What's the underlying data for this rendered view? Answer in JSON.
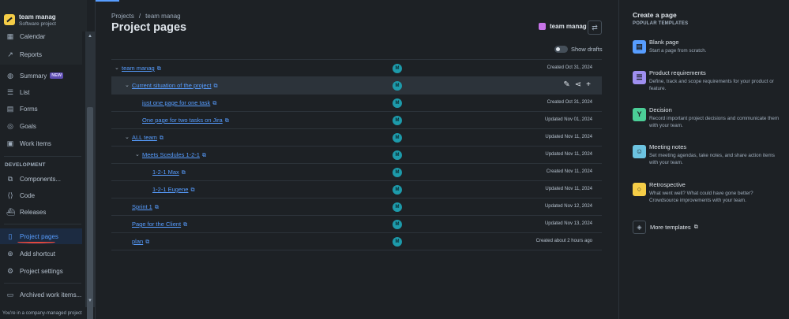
{
  "project": {
    "name": "team manag",
    "type": "Software project"
  },
  "sidebar": {
    "top_items": [
      {
        "label": "Calendar",
        "icon": "calendar-icon"
      },
      {
        "label": "Reports",
        "icon": "chart-icon"
      }
    ],
    "items": [
      {
        "label": "Summary",
        "icon": "globe-icon",
        "badge": "NEW"
      },
      {
        "label": "List",
        "icon": "list-icon"
      },
      {
        "label": "Forms",
        "icon": "forms-icon"
      },
      {
        "label": "Goals",
        "icon": "target-icon"
      },
      {
        "label": "Work items",
        "icon": "stack-icon"
      }
    ],
    "section_label": "DEVELOPMENT",
    "dev_items": [
      {
        "label": "Components...",
        "icon": "components-icon"
      },
      {
        "label": "Code",
        "icon": "code-icon"
      },
      {
        "label": "Releases",
        "icon": "ship-icon"
      }
    ],
    "bottom_items": [
      {
        "label": "Project pages",
        "icon": "pages-icon"
      },
      {
        "label": "Add shortcut",
        "icon": "link-icon"
      },
      {
        "label": "Project settings",
        "icon": "gear-icon"
      }
    ],
    "archived": "Archived work items...",
    "footer": "You're in a company-managed project"
  },
  "main": {
    "breadcrumbs": [
      "Projects",
      "team manag"
    ],
    "title": "Project pages",
    "space_name": "team manag",
    "show_drafts": "Show drafts",
    "pages": [
      {
        "title": "team manag",
        "status": "Created Oct 31, 2024",
        "avatar": "M"
      },
      {
        "title": "Current situation of the project",
        "status": "",
        "avatar": "M"
      },
      {
        "title": "just one page for one task",
        "status": "Created Oct 31, 2024",
        "avatar": "M"
      },
      {
        "title": "One page for two tasks on Jira",
        "status": "Updated Nov 01, 2024",
        "avatar": "M"
      },
      {
        "title": "ALL team",
        "status": "Updated Nov 11, 2024",
        "avatar": "M"
      },
      {
        "title": "Meets Scedules 1-2-1",
        "status": "Updated Nov 11, 2024",
        "avatar": "M"
      },
      {
        "title": "1-2-1 Max",
        "status": "Created Nov 11, 2024",
        "avatar": "M"
      },
      {
        "title": "1-2-1 Eugene",
        "status": "Updated Nov 11, 2024",
        "avatar": "M"
      },
      {
        "title": "Sprint 1",
        "status": "Updated Nov 12, 2024",
        "avatar": "M"
      },
      {
        "title": "Page for the Client",
        "status": "Updated Nov 13, 2024",
        "avatar": "M"
      },
      {
        "title": "plan",
        "status": "Created about 2 hours ago",
        "avatar": "M"
      }
    ]
  },
  "right_panel": {
    "title": "Create a page",
    "subtitle": "POPULAR TEMPLATES",
    "templates": [
      {
        "name": "Blank page",
        "desc": "Start a page from scratch.",
        "icon": "document-icon",
        "color": "#579dff"
      },
      {
        "name": "Product requirements",
        "desc": "Define, track and scope requirements for your product or feature.",
        "icon": "list-icon",
        "color": "#9f8fef"
      },
      {
        "name": "Decision",
        "desc": "Record important project decisions and communicate them with your team.",
        "icon": "fork-icon",
        "color": "#4bce97"
      },
      {
        "name": "Meeting notes",
        "desc": "Set meeting agendas, take notes, and share action items with your team.",
        "icon": "people-icon",
        "color": "#6cc3e0"
      },
      {
        "name": "Retrospective",
        "desc": "What went well? What could have gone better? Crowdsource improvements with your team.",
        "icon": "chat-icon",
        "color": "#f5cd47"
      }
    ],
    "more": "More templates"
  }
}
